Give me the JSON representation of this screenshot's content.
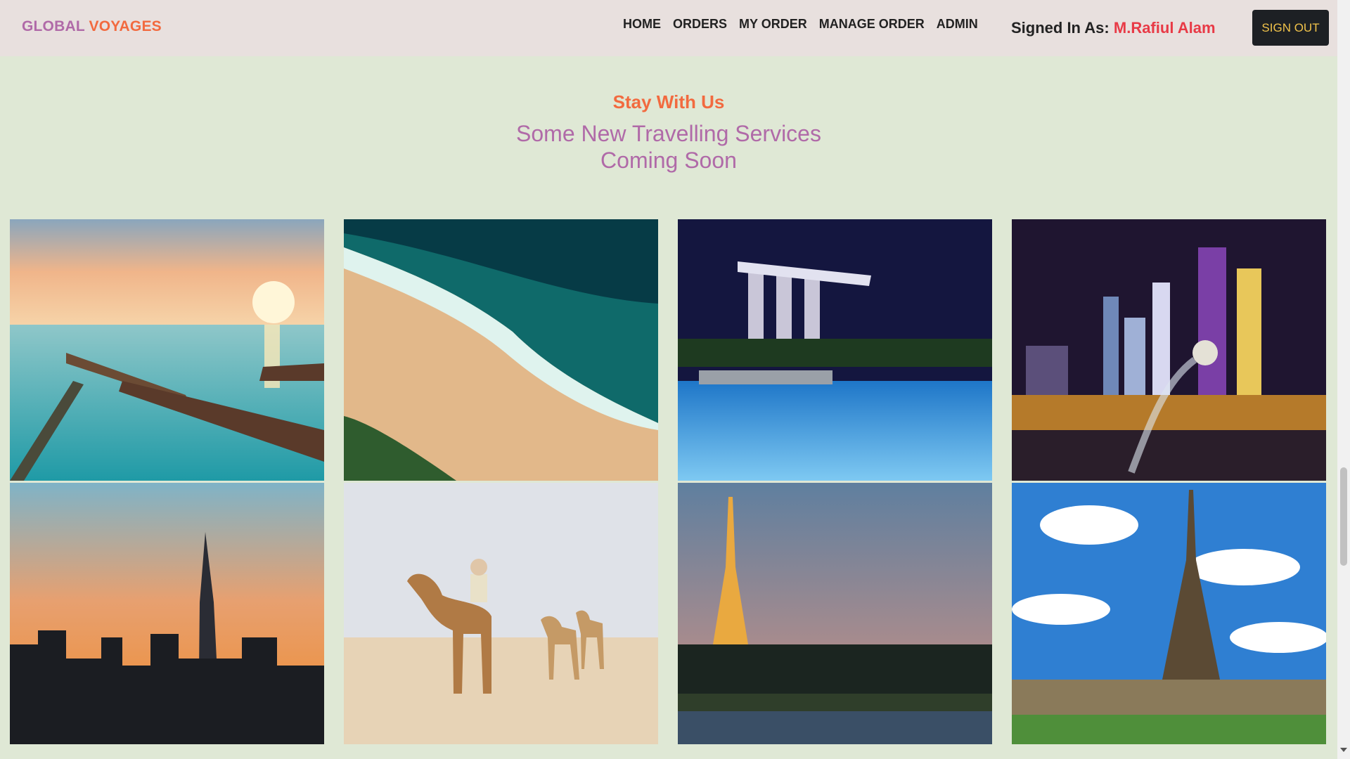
{
  "brand": {
    "word1": "GLOBAL",
    "word2": "VOYAGES"
  },
  "nav": {
    "items": [
      "HOME",
      "ORDERS",
      "MY ORDER",
      "MANAGE ORDER",
      "ADMIN"
    ]
  },
  "user": {
    "prefix": "Signed In As:",
    "name": "M.Rafiul Alam"
  },
  "signout_label": "SIGN OUT",
  "section": {
    "subtitle": "Stay With Us",
    "title_line1": "Some New Travelling Services",
    "title_line2": "Coming Soon"
  },
  "gallery": {
    "images": [
      "maldives-water-villas-sunset",
      "aerial-beach-turquoise-waves",
      "marina-bay-sands-pool-night",
      "singapore-merlion-skyline-night",
      "city-skyline-sunset-silhouette",
      "desert-camel-riders",
      "eiffel-tower-dusk-river",
      "eiffel-tower-blue-sky-clouds"
    ]
  },
  "colors": {
    "page_bg": "#dfe8d5",
    "navbar_bg": "#e8e0de",
    "brand_purple": "#b06aa8",
    "accent_orange": "#f26a3f",
    "user_red": "#e83a46",
    "button_dark": "#1d2024",
    "button_text": "#f0c24a"
  }
}
